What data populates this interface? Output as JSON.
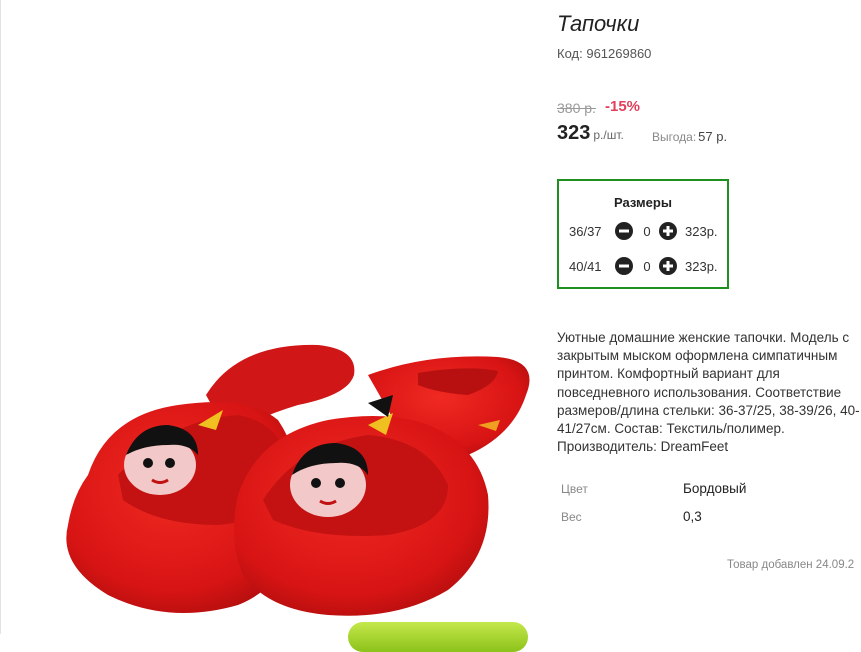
{
  "product": {
    "title": "Тапочки",
    "code_label": "Код:",
    "code_value": "961269860",
    "old_price": "380 р.",
    "discount": "-15%",
    "price": "323",
    "price_unit": "р./шт.",
    "savings_label": "Выгода:",
    "savings_value": "57 р."
  },
  "sizes": {
    "title": "Размеры",
    "items": [
      {
        "label": "36/37",
        "qty": "0",
        "price": "323р."
      },
      {
        "label": "40/41",
        "qty": "0",
        "price": "323р."
      }
    ]
  },
  "description": "Уютные домашние женские тапочки. Модель с закрытым мыском оформлена симпатичным принтом. Комфортный вариант для повседневного использования. Соответствие размеров/длина стельки: 36-37/25, 38-39/26, 40-41/27см. Состав: Текстиль/полимер. Производитель: DreamFeet",
  "attributes": [
    {
      "label": "Цвет",
      "value": "Бордовый"
    },
    {
      "label": "Вес",
      "value": "0,3"
    }
  ],
  "added": "Товар добавлен 24.09.2",
  "colors": {
    "accent_border": "#1f8f1f",
    "discount": "#e0405c",
    "slipper": "#e01818",
    "cta": "#9ccf1e"
  }
}
